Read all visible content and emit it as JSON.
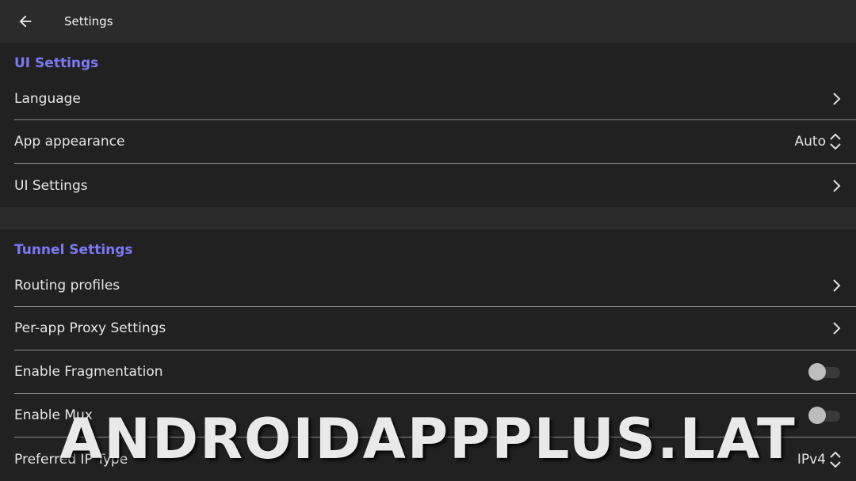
{
  "topbar": {
    "title": "Settings",
    "back_icon": "arrow-left-icon"
  },
  "sections": {
    "ui": {
      "header": "UI Settings",
      "items": [
        {
          "label": "Language",
          "trail": "chevron-right-icon"
        },
        {
          "label": "App appearance",
          "value": "Auto",
          "trail": "chevron-up-down-icon"
        },
        {
          "label": "UI Settings",
          "trail": "chevron-right-icon"
        }
      ]
    },
    "tunnel": {
      "header": "Tunnel Settings",
      "items": [
        {
          "label": "Routing profiles",
          "trail": "chevron-right-icon"
        },
        {
          "label": "Per-app Proxy Settings",
          "trail": "chevron-right-icon"
        },
        {
          "label": "Enable Fragmentation",
          "toggle": false
        },
        {
          "label": "Enable Mux",
          "toggle": false
        },
        {
          "label": "Preferred IP Type",
          "value": "IPv4",
          "trail": "chevron-up-down-icon"
        }
      ]
    }
  },
  "watermark": "ANDROIDAPPPLUS.LAT",
  "colors": {
    "accent": "#7b79f3",
    "background": "#212121",
    "topbar": "#2b2b2b",
    "divider": "#8a8a8a"
  }
}
